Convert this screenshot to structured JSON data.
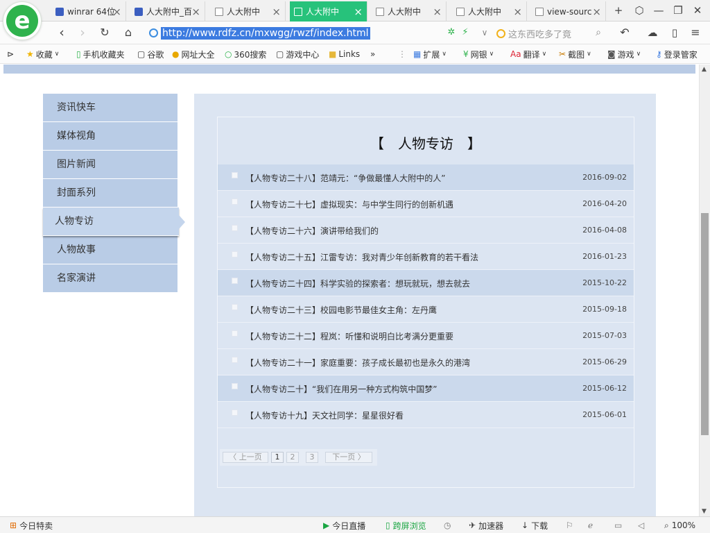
{
  "browser": {
    "tabs": [
      {
        "label": "winrar 64位"
      },
      {
        "label": "人大附中_百"
      },
      {
        "label": "人大附中"
      },
      {
        "label": "人大附中"
      },
      {
        "label": "人大附中"
      },
      {
        "label": "人大附中"
      },
      {
        "label": "view-sourc"
      }
    ],
    "active_tab_color": "#27c27b",
    "address": "http://www.rdfz.cn/mxwgg/rwzf/index.html",
    "search_placeholder": "这东西吃多了竟",
    "bookmarks": [
      {
        "label": "收藏"
      },
      {
        "label": "手机收藏夹"
      },
      {
        "label": "谷歌"
      },
      {
        "label": "网址大全"
      },
      {
        "label": "360搜索"
      },
      {
        "label": "游戏中心"
      },
      {
        "label": "Links"
      }
    ],
    "tools": [
      {
        "label": "扩展"
      },
      {
        "label": "网银"
      },
      {
        "label": "翻译"
      },
      {
        "label": "截图"
      },
      {
        "label": "游戏"
      },
      {
        "label": "登录管家"
      }
    ],
    "status": {
      "left": "今日特卖",
      "live": "今日直播",
      "cross": "跨屏浏览",
      "accelerate": "加速器",
      "download": "下载",
      "zoom": "100%"
    }
  },
  "sidebar": {
    "items": [
      {
        "label": "资讯快车"
      },
      {
        "label": "媒体视角"
      },
      {
        "label": "图片新闻"
      },
      {
        "label": "封面系列"
      },
      {
        "label": "人物专访"
      },
      {
        "label": "人物故事"
      },
      {
        "label": "名家演讲"
      }
    ],
    "active_index": 4
  },
  "main": {
    "title": "【　人物专访　】",
    "articles": [
      {
        "title": "【人物专访二十八】范靖元：“争做最懂人大附中的人”",
        "date": "2016-09-02"
      },
      {
        "title": "【人物专访二十七】虚拟现实：与中学生同行的创新机遇",
        "date": "2016-04-20"
      },
      {
        "title": "【人物专访二十六】演讲带给我们的",
        "date": "2016-04-08"
      },
      {
        "title": "【人物专访二十五】江雷专访：我对青少年创新教育的若干看法",
        "date": "2016-01-23"
      },
      {
        "title": "【人物专访二十四】科学实验的探索者：想玩就玩，想去就去",
        "date": "2015-10-22"
      },
      {
        "title": "【人物专访二十三】校园电影节最佳女主角：左丹鹰",
        "date": "2015-09-18"
      },
      {
        "title": "【人物专访二十二】程岚：听懂和说明白比考满分更重要",
        "date": "2015-07-03"
      },
      {
        "title": "【人物专访二十一】家庭重要：孩子成长最初也是永久的港湾",
        "date": "2015-06-29"
      },
      {
        "title": "【人物专访二十】“我们在用另一种方式构筑中国梦”",
        "date": "2015-06-12"
      },
      {
        "title": "【人物专访十九】天文社同学：星星很好看",
        "date": "2015-06-01"
      }
    ],
    "pager": {
      "prev": "〈 上一页",
      "pages": [
        "1",
        "2",
        "3"
      ],
      "current": "1",
      "next": "下一页 〉"
    }
  }
}
